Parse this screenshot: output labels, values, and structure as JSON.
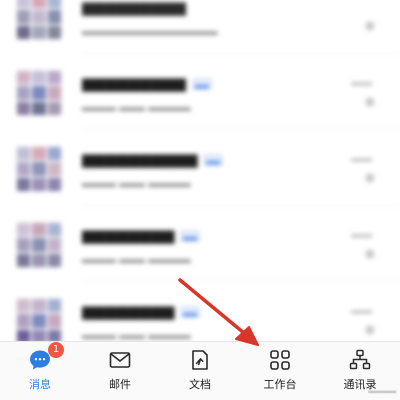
{
  "tab_bar": {
    "items": [
      {
        "label": "消息",
        "icon": "chat-bubble-icon",
        "badge": "1",
        "active": true
      },
      {
        "label": "邮件",
        "icon": "mail-icon",
        "active": false
      },
      {
        "label": "文档",
        "icon": "document-icon",
        "active": false
      },
      {
        "label": "工作台",
        "icon": "workbench-grid-icon",
        "active": false
      },
      {
        "label": "通讯录",
        "icon": "org-chart-icon",
        "active": false
      }
    ]
  },
  "colors": {
    "accent": "#2e7de1",
    "badge": "#f25643",
    "arrow": "#d9362b",
    "text": "#1e1e1e"
  }
}
